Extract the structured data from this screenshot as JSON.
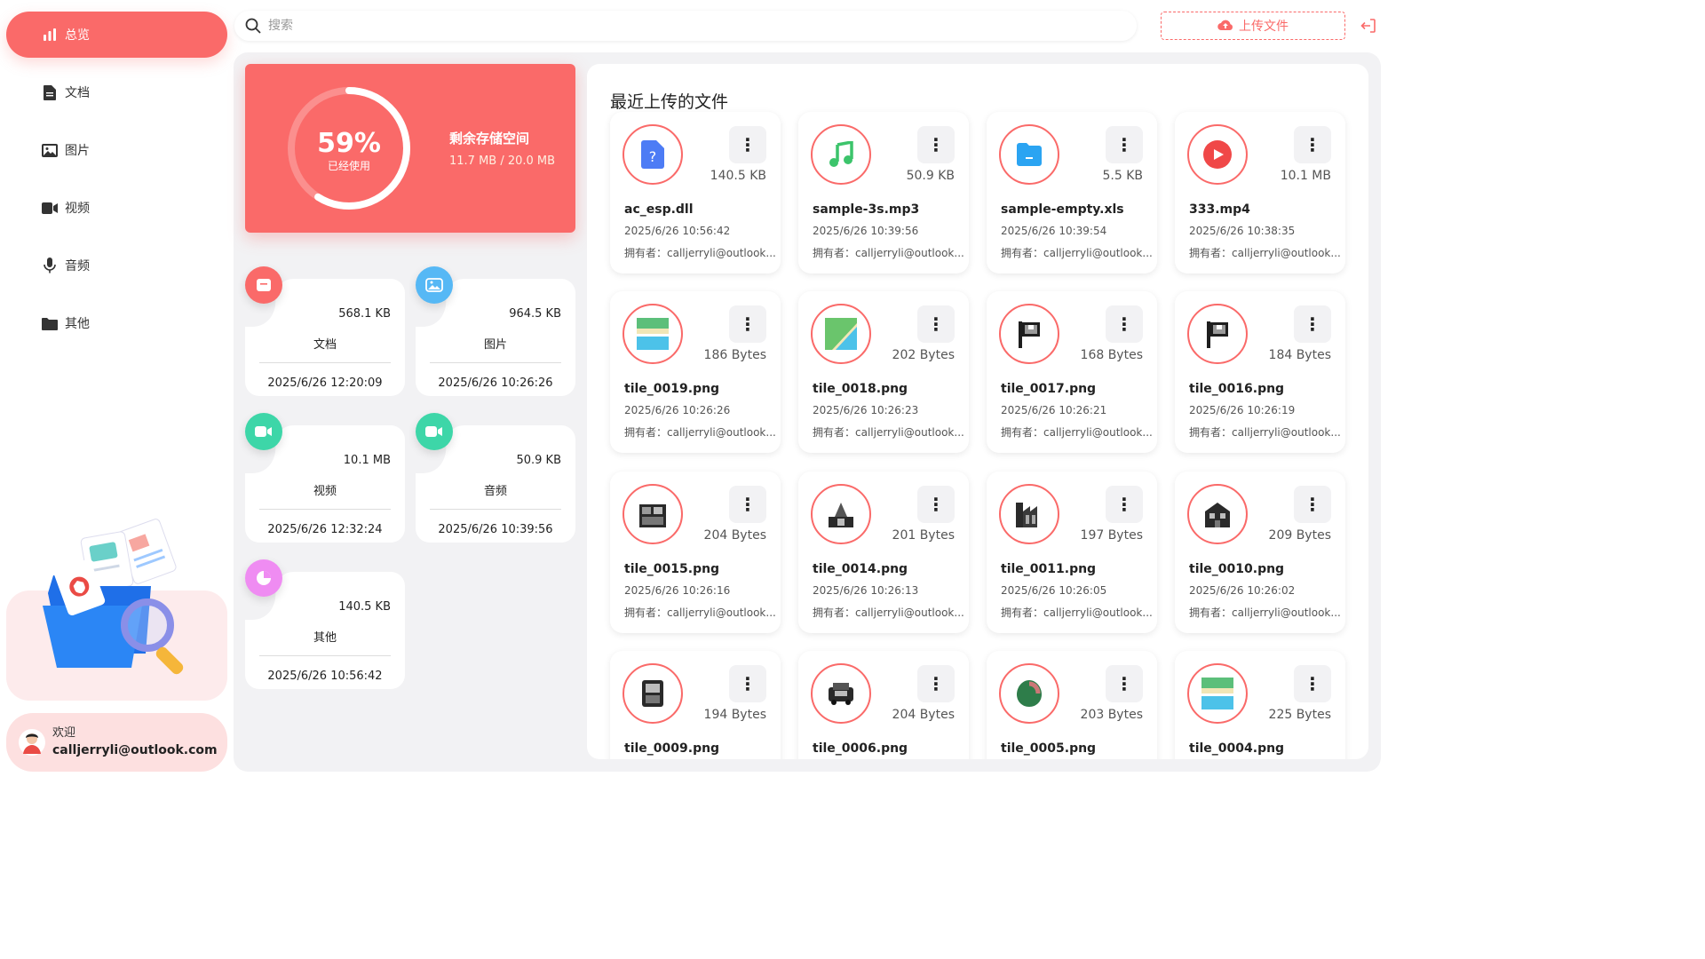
{
  "sidebar": {
    "items": [
      {
        "label": "总览",
        "icon": "chart-icon",
        "active": true
      },
      {
        "label": "文档",
        "icon": "document-icon"
      },
      {
        "label": "图片",
        "icon": "image-icon"
      },
      {
        "label": "视频",
        "icon": "video-icon"
      },
      {
        "label": "音频",
        "icon": "microphone-icon"
      },
      {
        "label": "其他",
        "icon": "folder-icon"
      }
    ],
    "user": {
      "welcome": "欢迎",
      "email": "calljerryli@outlook.com"
    }
  },
  "header": {
    "search_placeholder": "搜索",
    "upload_label": "上传文件"
  },
  "storage": {
    "percent_label": "59%",
    "percent_value": 59,
    "used_label": "已经使用",
    "remaining_title": "剩余存储空间",
    "remaining_value": "11.7 MB / 20.0 MB"
  },
  "categories": [
    {
      "name": "文档",
      "size": "568.1 KB",
      "time": "2025/6/26 12:20:09",
      "color": "#fa6a69",
      "icon": "document-icon"
    },
    {
      "name": "图片",
      "size": "964.5 KB",
      "time": "2025/6/26 10:26:26",
      "color": "#56b8f5",
      "icon": "image-icon"
    },
    {
      "name": "视频",
      "size": "10.1 MB",
      "time": "2025/6/26 12:32:24",
      "color": "#3dd6a8",
      "icon": "video-icon"
    },
    {
      "name": "音频",
      "size": "50.9 KB",
      "time": "2025/6/26 10:39:56",
      "color": "#3dd6a8",
      "icon": "video-icon"
    },
    {
      "name": "其他",
      "size": "140.5 KB",
      "time": "2025/6/26 10:56:42",
      "color": "#ef8cf2",
      "icon": "pie-icon"
    }
  ],
  "recent": {
    "title": "最近上传的文件",
    "owner_label": "拥有者：",
    "files": [
      {
        "name": "ac_esp.dll",
        "size": "140.5 KB",
        "time": "2025/6/26 10:56:42",
        "owner": "calljerryli@outlook...",
        "icon": "unknown-file-icon"
      },
      {
        "name": "sample-3s.mp3",
        "size": "50.9 KB",
        "time": "2025/6/26 10:39:56",
        "owner": "calljerryli@outlook...",
        "icon": "music-icon"
      },
      {
        "name": "sample-empty.xls",
        "size": "5.5 KB",
        "time": "2025/6/26 10:39:54",
        "owner": "calljerryli@outlook...",
        "icon": "spreadsheet-icon"
      },
      {
        "name": "333.mp4",
        "size": "10.1 MB",
        "time": "2025/6/26 10:38:35",
        "owner": "calljerryli@outlook...",
        "icon": "play-icon"
      },
      {
        "name": "tile_0019.png",
        "size": "186 Bytes",
        "time": "2025/6/26 10:26:26",
        "owner": "calljerryli@outlook...",
        "icon": "tile-water-thumbnail"
      },
      {
        "name": "tile_0018.png",
        "size": "202 Bytes",
        "time": "2025/6/26 10:26:23",
        "owner": "calljerryli@outlook...",
        "icon": "tile-shore-thumbnail"
      },
      {
        "name": "tile_0017.png",
        "size": "168 Bytes",
        "time": "2025/6/26 10:26:21",
        "owner": "calljerryli@outlook...",
        "icon": "tile-flag-thumbnail"
      },
      {
        "name": "tile_0016.png",
        "size": "184 Bytes",
        "time": "2025/6/26 10:26:19",
        "owner": "calljerryli@outlook...",
        "icon": "tile-flag-thumbnail"
      },
      {
        "name": "tile_0015.png",
        "size": "204 Bytes",
        "time": "2025/6/26 10:26:16",
        "owner": "calljerryli@outlook...",
        "icon": "tile-building-thumbnail"
      },
      {
        "name": "tile_0014.png",
        "size": "201 Bytes",
        "time": "2025/6/26 10:26:13",
        "owner": "calljerryli@outlook...",
        "icon": "tile-tower-thumbnail"
      },
      {
        "name": "tile_0011.png",
        "size": "197 Bytes",
        "time": "2025/6/26 10:26:05",
        "owner": "calljerryli@outlook...",
        "icon": "tile-factory-thumbnail"
      },
      {
        "name": "tile_0010.png",
        "size": "209 Bytes",
        "time": "2025/6/26 10:26:02",
        "owner": "calljerryli@outlook...",
        "icon": "tile-house-thumbnail"
      },
      {
        "name": "tile_0009.png",
        "size": "194 Bytes",
        "time": "",
        "owner": "",
        "icon": "tile-machine-thumbnail"
      },
      {
        "name": "tile_0006.png",
        "size": "204 Bytes",
        "time": "",
        "owner": "",
        "icon": "tile-cart-thumbnail"
      },
      {
        "name": "tile_0005.png",
        "size": "203 Bytes",
        "time": "",
        "owner": "",
        "icon": "tile-tree-thumbnail"
      },
      {
        "name": "tile_0004.png",
        "size": "225 Bytes",
        "time": "",
        "owner": "",
        "icon": "tile-water-thumbnail"
      }
    ]
  }
}
